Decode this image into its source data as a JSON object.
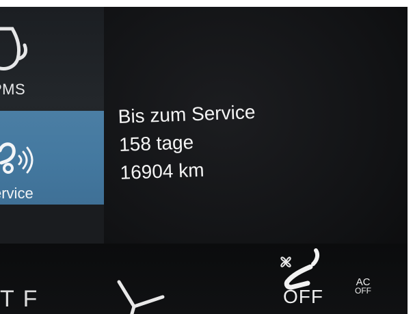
{
  "sidebar": {
    "items": [
      {
        "label": "PMS",
        "icon": "tire-pressure-icon",
        "selected": false
      },
      {
        "label": "ervice",
        "icon": "car-service-icon",
        "selected": true
      }
    ],
    "selected_color": "#4779a0"
  },
  "main": {
    "lines": [
      "Bis zum Service",
      "158 tage",
      "16904 km"
    ]
  },
  "climate": {
    "partial_left_text": "T F",
    "seat_icon": "seat-heating-icon",
    "fan_icon": "fan-icon",
    "seat_vent_icon": "seat-ventilation-icon",
    "seat_off_label": "OFF",
    "ac_label": "AC",
    "ac_state": "OFF"
  }
}
